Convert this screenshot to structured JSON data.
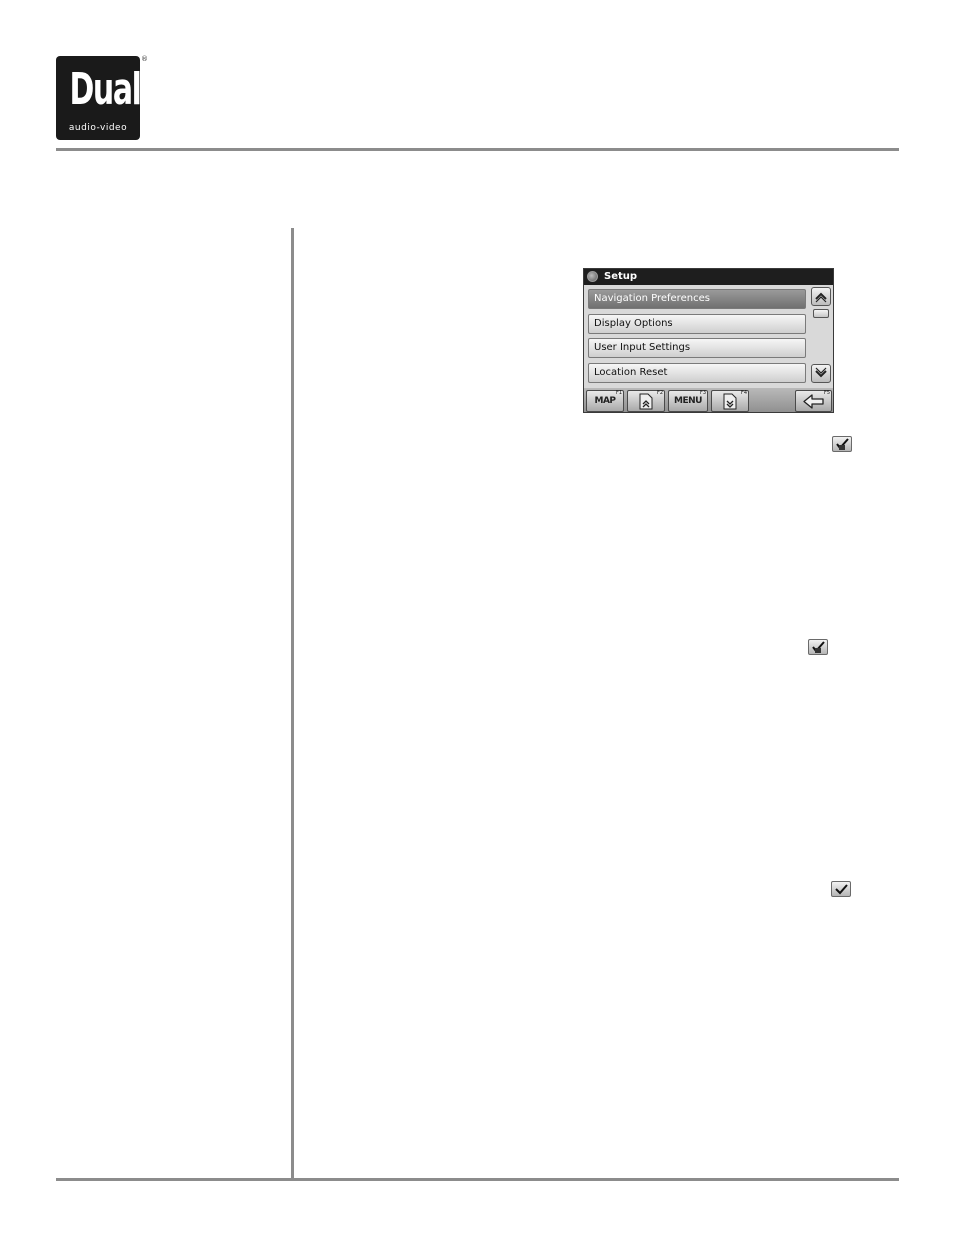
{
  "logo": {
    "brand": "Dual",
    "tagline": "audio-video",
    "registered": "®"
  },
  "setup_screen": {
    "title": "Setup",
    "menu_items": [
      {
        "label": "Navigation Preferences",
        "selected": true
      },
      {
        "label": "Display Options",
        "selected": false
      },
      {
        "label": "User Input Settings",
        "selected": false
      },
      {
        "label": "Location Reset",
        "selected": false
      }
    ],
    "function_keys": [
      {
        "label": "MAP",
        "key": "F1",
        "icon": "map-label"
      },
      {
        "label": "",
        "key": "F2",
        "icon": "page-up-icon"
      },
      {
        "label": "MENU",
        "key": "F3",
        "icon": "menu-label"
      },
      {
        "label": "",
        "key": "F4",
        "icon": "page-down-icon"
      },
      {
        "label": "",
        "key": "F5",
        "icon": "back-arrow-icon"
      }
    ]
  },
  "icons": {
    "check_1": "check-edit-icon",
    "check_2": "check-edit-icon",
    "check_3": "checkmark-icon"
  },
  "colors": {
    "rule": "#8c8c8c",
    "logo_bg": "#1a1a1a",
    "title_bar": "#1e1e1e"
  }
}
